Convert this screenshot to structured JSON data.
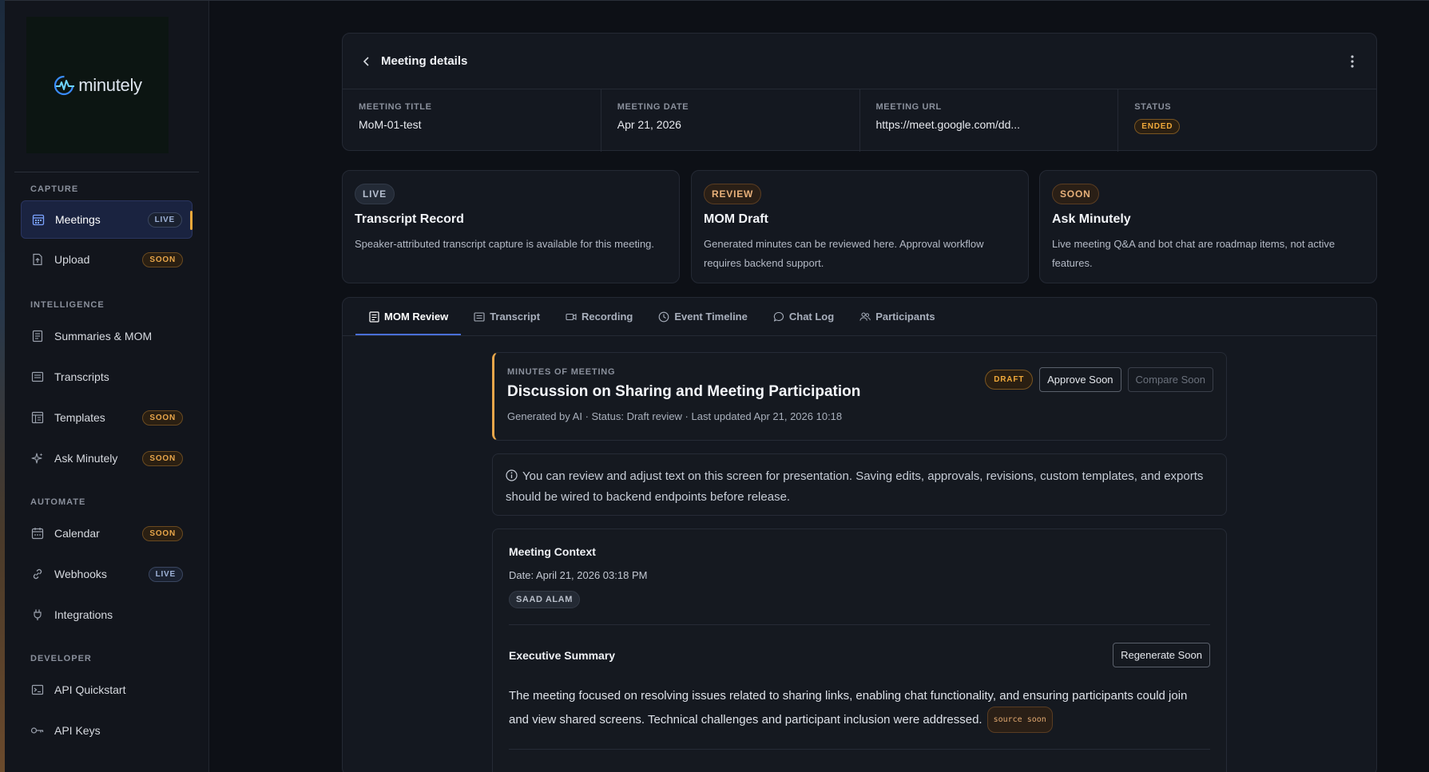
{
  "sidebar": {
    "logo_text": "minutely",
    "sections": {
      "capture": "CAPTURE",
      "intelligence": "INTELLIGENCE",
      "automate": "AUTOMATE",
      "developer": "DEVELOPER"
    },
    "items": [
      {
        "label": "Meetings",
        "badge": "LIVE",
        "icon": "calendar-grid-icon",
        "active": true
      },
      {
        "label": "Upload",
        "badge": "SOON",
        "icon": "upload-file-icon"
      },
      {
        "label": "Summaries & MOM",
        "icon": "document-list-icon"
      },
      {
        "label": "Transcripts",
        "icon": "transcript-icon"
      },
      {
        "label": "Templates",
        "badge": "SOON",
        "icon": "template-icon"
      },
      {
        "label": "Ask Minutely",
        "badge": "SOON",
        "icon": "sparkle-icon"
      },
      {
        "label": "Calendar",
        "badge": "SOON",
        "icon": "calendar-icon"
      },
      {
        "label": "Webhooks",
        "badge": "LIVE",
        "icon": "link-icon"
      },
      {
        "label": "Integrations",
        "icon": "plug-icon"
      },
      {
        "label": "API Quickstart",
        "icon": "terminal-icon"
      },
      {
        "label": "API Keys",
        "icon": "key-icon"
      }
    ]
  },
  "header": {
    "title": "Meeting details",
    "meta": [
      {
        "label": "MEETING TITLE",
        "value": "MoM-01-test"
      },
      {
        "label": "MEETING DATE",
        "value": "Apr 21, 2026"
      },
      {
        "label": "MEETING URL",
        "value": "https://meet.google.com/dd..."
      },
      {
        "label": "STATUS",
        "value": "ENDED"
      }
    ]
  },
  "features": [
    {
      "pill": "LIVE",
      "title": "Transcript Record",
      "desc": "Speaker-attributed transcript capture is available for this meeting."
    },
    {
      "pill": "REVIEW",
      "title": "MOM Draft",
      "desc": "Generated minutes can be reviewed here. Approval workflow requires backend support."
    },
    {
      "pill": "SOON",
      "title": "Ask Minutely",
      "desc": "Live meeting Q&A and bot chat are roadmap items, not active features."
    }
  ],
  "tabs": [
    "MOM Review",
    "Transcript",
    "Recording",
    "Event Timeline",
    "Chat Log",
    "Participants"
  ],
  "mom": {
    "kicker": "MINUTES OF MEETING",
    "title": "Discussion on Sharing and Meeting Participation",
    "subtitle": "Generated by AI · Status: Draft review · Last updated Apr 21, 2026 10:18",
    "draft_badge": "DRAFT",
    "approve_label": "Approve Soon",
    "compare_label": "Compare Soon"
  },
  "info": {
    "text": "You can review and adjust text on this screen for presentation. Saving edits, approvals, revisions, custom templates, and exports should be wired to backend endpoints before release."
  },
  "context": {
    "heading": "Meeting Context",
    "date": "Date: April 21, 2026 03:18 PM",
    "participant": "SAAD ALAM",
    "exec_heading": "Executive Summary",
    "regenerate_label": "Regenerate Soon",
    "exec_text": "The meeting focused on resolving issues related to sharing links, enabling chat functionality, and ensuring participants could join and view shared screens. Technical challenges and participant inclusion were addressed.",
    "source_chip": "source soon"
  },
  "colors": {
    "accent_orange": "#f0a93a",
    "accent_blue": "#4a6fd8",
    "background": "#0d1016"
  }
}
